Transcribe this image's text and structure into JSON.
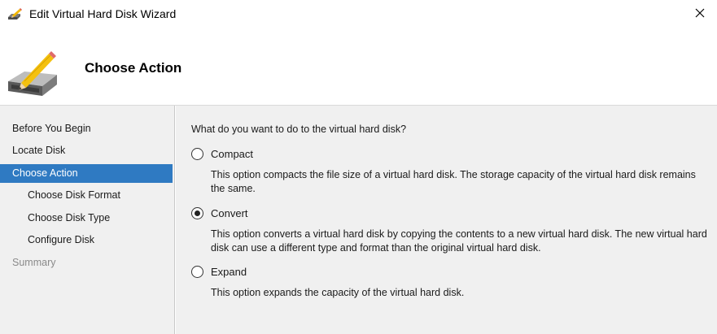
{
  "window": {
    "title": "Edit Virtual Hard Disk Wizard",
    "icon": "disk-pencil-icon",
    "close_icon": "close-icon"
  },
  "header": {
    "title": "Choose Action",
    "icon": "disk-pencil-large-icon"
  },
  "sidebar": {
    "items": [
      {
        "label": "Before You Begin",
        "state": "normal"
      },
      {
        "label": "Locate Disk",
        "state": "normal"
      },
      {
        "label": "Choose Action",
        "state": "active"
      },
      {
        "label": "Choose Disk Format",
        "state": "normal"
      },
      {
        "label": "Choose Disk Type",
        "state": "normal"
      },
      {
        "label": "Configure Disk",
        "state": "normal"
      },
      {
        "label": "Summary",
        "state": "disabled"
      }
    ]
  },
  "main": {
    "question": "What do you want to do to the virtual hard disk?",
    "options": [
      {
        "label": "Compact",
        "checked": false,
        "description": "This option compacts the file size of a virtual hard disk. The storage capacity of the virtual hard disk remains the same."
      },
      {
        "label": "Convert",
        "checked": true,
        "description": "This option converts a virtual hard disk by copying the contents to a new virtual hard disk. The new virtual hard disk can use a different type and format than the original virtual hard disk."
      },
      {
        "label": "Expand",
        "checked": false,
        "description": "This option expands the capacity of the virtual hard disk."
      }
    ]
  },
  "colors": {
    "active_nav": "#2f7ac2",
    "panel_bg": "#f0f0f0"
  }
}
